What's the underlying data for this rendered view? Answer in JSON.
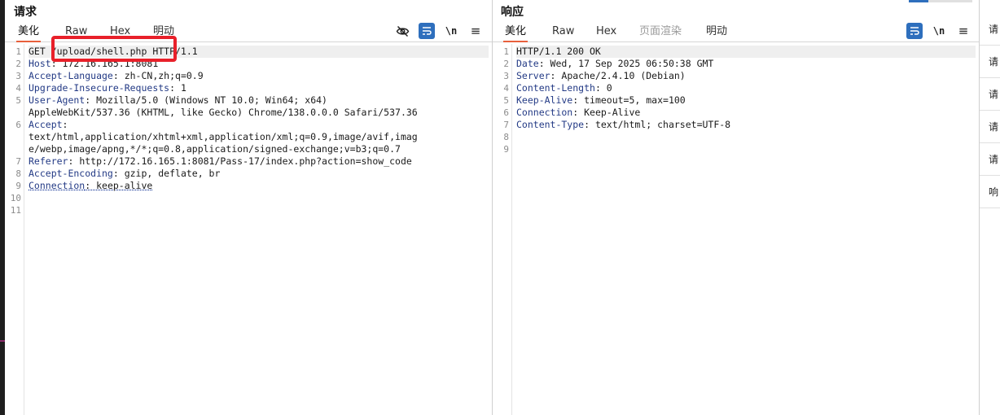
{
  "request": {
    "title": "请求",
    "tabs": [
      "美化",
      "Raw",
      "Hex",
      "明动"
    ],
    "active_tab": "美化",
    "tool_newline": "\\n",
    "tool_menu": "≡",
    "lines": [
      {
        "num": "1",
        "key": "",
        "text": "GET /upload/shell.php HTTP/1.1"
      },
      {
        "num": "2",
        "key": "Host",
        "text": ": 172.16.165.1:8081"
      },
      {
        "num": "3",
        "key": "Accept-Language",
        "text": ": zh-CN,zh;q=0.9"
      },
      {
        "num": "4",
        "key": "Upgrade-Insecure-Requests",
        "text": ": 1"
      },
      {
        "num": "5",
        "key": "User-Agent",
        "text": ": Mozilla/5.0 (Windows NT 10.0; Win64; x64)"
      },
      {
        "num": "",
        "key": "",
        "text": "AppleWebKit/537.36 (KHTML, like Gecko) Chrome/138.0.0.0 Safari/537.36"
      },
      {
        "num": "6",
        "key": "Accept",
        "text": ":"
      },
      {
        "num": "",
        "key": "",
        "text": "text/html,application/xhtml+xml,application/xml;q=0.9,image/avif,imag"
      },
      {
        "num": "",
        "key": "",
        "text": "e/webp,image/apng,*/*;q=0.8,application/signed-exchange;v=b3;q=0.7"
      },
      {
        "num": "7",
        "key": "Referer",
        "text": ": http://172.16.165.1:8081/Pass-17/index.php?action=show_code"
      },
      {
        "num": "8",
        "key": "Accept-Encoding",
        "text": ": gzip, deflate, br"
      },
      {
        "num": "9",
        "key": "Connection",
        "text": ": keep-alive"
      },
      {
        "num": "10",
        "key": "",
        "text": ""
      },
      {
        "num": "11",
        "key": "",
        "text": ""
      }
    ]
  },
  "response": {
    "title": "响应",
    "tabs": [
      "美化",
      "Raw",
      "Hex",
      "页面渲染",
      "明动"
    ],
    "active_tab": "美化",
    "tool_newline": "\\n",
    "tool_menu": "≡",
    "lines": [
      {
        "num": "1",
        "key": "",
        "text": "HTTP/1.1 200 OK"
      },
      {
        "num": "2",
        "key": "Date",
        "text": ": Wed, 17 Sep 2025 06:50:38 GMT"
      },
      {
        "num": "3",
        "key": "Server",
        "text": ": Apache/2.4.10 (Debian)"
      },
      {
        "num": "4",
        "key": "Content-Length",
        "text": ": 0"
      },
      {
        "num": "5",
        "key": "Keep-Alive",
        "text": ": timeout=5, max=100"
      },
      {
        "num": "6",
        "key": "Connection",
        "text": ": Keep-Alive"
      },
      {
        "num": "7",
        "key": "Content-Type",
        "text": ": text/html; charset=UTF-8"
      },
      {
        "num": "8",
        "key": "",
        "text": ""
      },
      {
        "num": "9",
        "key": "",
        "text": ""
      }
    ]
  },
  "sidebar": {
    "items": [
      "请",
      "请",
      "请",
      "请",
      "请",
      "响"
    ]
  },
  "colors": {
    "accent_tab": "#e8603c",
    "header_key": "#233a85",
    "annotation_box": "#e8202a",
    "tool_active": "#2e6fbd"
  }
}
